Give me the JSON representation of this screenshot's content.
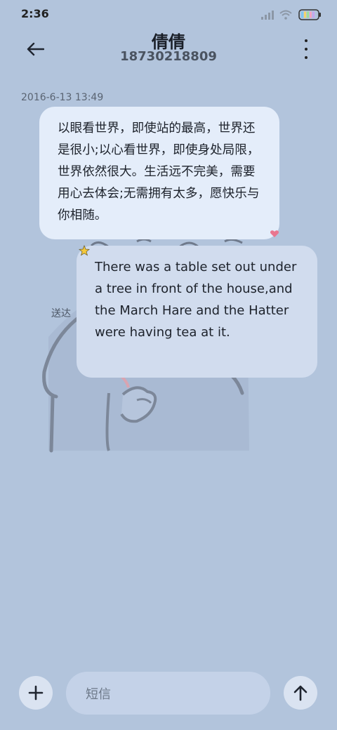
{
  "status_bar": {
    "time": "2:36",
    "icons": [
      "signal-icon",
      "wifi-icon",
      "battery-icon"
    ]
  },
  "header": {
    "contact_name": "倩倩",
    "contact_number": "18730218809",
    "back_icon": "arrow-left-icon",
    "more_icon": "more-vertical-icon"
  },
  "conversation": {
    "timestamp": "2016-6-13 13:49",
    "messages": [
      {
        "text": "以眼看世界，即使站的最高，世界还是很小;以心看世界，即使身处局限，世界依然很大。生活远不完美，需要用心去体会;无需拥有太多，愿快乐与你相随。"
      },
      {
        "text": "There was a table set out under a tree in front of the house,and the March Hare and the Hatter were having tea at it."
      }
    ],
    "delivered_label": "送达"
  },
  "composer": {
    "add_icon": "plus-icon",
    "input_placeholder": "短信",
    "send_icon": "arrow-up-icon"
  },
  "colors": {
    "background": "#b2c4dc",
    "bubble_primary": "#e4edfa",
    "bubble_secondary": "#d1dcee",
    "button_bg": "#dae3f1",
    "input_bg": "#c4d2e8"
  }
}
